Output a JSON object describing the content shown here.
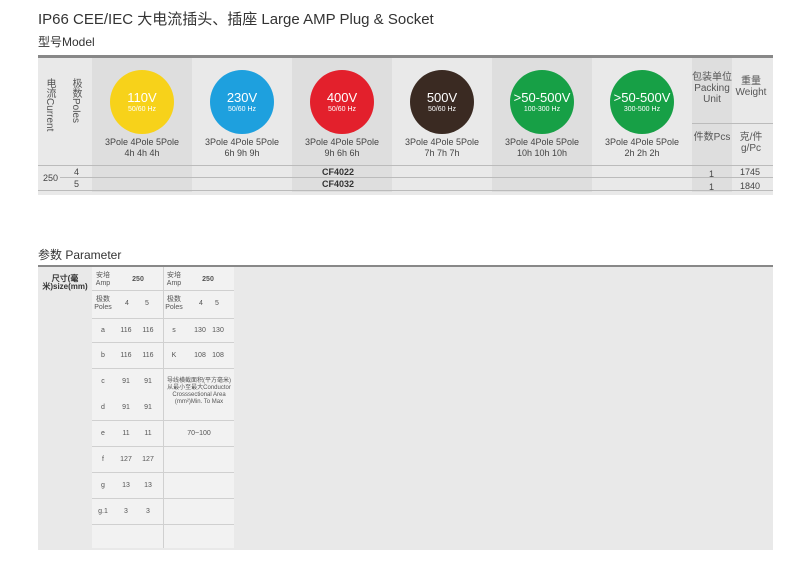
{
  "title": "IP66 CEE/IEC 大电流插头、插座  Large AMP Plug & Socket",
  "model_label": "型号Model",
  "model_table": {
    "current_header": "电流Current",
    "poles_header": "极数Poles",
    "voltages": [
      {
        "voltage": "110V",
        "freq": "50/60 Hz",
        "color": "#f7d21a",
        "poles": "3Pole 4Pole 5Pole",
        "h": "4h    4h    4h"
      },
      {
        "voltage": "230V",
        "freq": "50/60 Hz",
        "color": "#1ea0de",
        "poles": "3Pole 4Pole 5Pole",
        "h": "6h    9h    9h"
      },
      {
        "voltage": "400V",
        "freq": "50/60 Hz",
        "color": "#e3202c",
        "poles": "3Pole 4Pole 5Pole",
        "h": "9h    6h    6h"
      },
      {
        "voltage": "500V",
        "freq": "50/60 Hz",
        "color": "#3a2a22",
        "poles": "3Pole 4Pole 5Pole",
        "h": "7h    7h    7h"
      },
      {
        "voltage": ">50-500V",
        "freq": "100-300 Hz",
        "color": "#17a046",
        "poles": "3Pole 4Pole 5Pole",
        "h": "10h   10h   10h"
      },
      {
        "voltage": ">50-500V",
        "freq": "300-500 Hz",
        "color": "#17a046",
        "poles": "3Pole 4Pole 5Pole",
        "h": "2h    2h    2h"
      }
    ],
    "packing_header": "包装单位Packing Unit",
    "weight_header": "重量Weight",
    "pcs_header": "件数Pcs",
    "gpc_header": "克/件g/Pc",
    "current_value": "250",
    "rows": [
      {
        "poles": "4",
        "code": "CF4022",
        "pcs": "1",
        "weight": "1745"
      },
      {
        "poles": "5",
        "code": "CF4032",
        "pcs": "1",
        "weight": "1840"
      }
    ]
  },
  "param_label": "参数 Parameter",
  "param_table": {
    "size_label": "尺寸(毫米)size(mm)",
    "amp_label": "安培Amp",
    "amp_value": "250",
    "amp_label2": "安培Amp",
    "amp_value2": "250",
    "poles_label": "极数Poles",
    "poles_vals": [
      "4",
      "5"
    ],
    "poles_label2": "极数Poles",
    "poles_vals2": [
      "4",
      "5"
    ],
    "conductor_label": "导线横截面积(平方毫米)从最小至最大Conductor Crosssectional Area (mm²)Min. To Max",
    "conductor_value": "70~100",
    "rows": [
      {
        "k": "a",
        "v1": "116",
        "v2": "116",
        "k2": "s",
        "w1": "130",
        "w2": "130"
      },
      {
        "k": "b",
        "v1": "116",
        "v2": "116",
        "k2": "K",
        "w1": "108",
        "w2": "108"
      },
      {
        "k": "c",
        "v1": "91",
        "v2": "91"
      },
      {
        "k": "d",
        "v1": "91",
        "v2": "91"
      },
      {
        "k": "e",
        "v1": "11",
        "v2": "11"
      },
      {
        "k": "f",
        "v1": "127",
        "v2": "127"
      },
      {
        "k": "g",
        "v1": "13",
        "v2": "13"
      },
      {
        "k": "g.1",
        "v1": "3",
        "v2": "3"
      }
    ]
  }
}
